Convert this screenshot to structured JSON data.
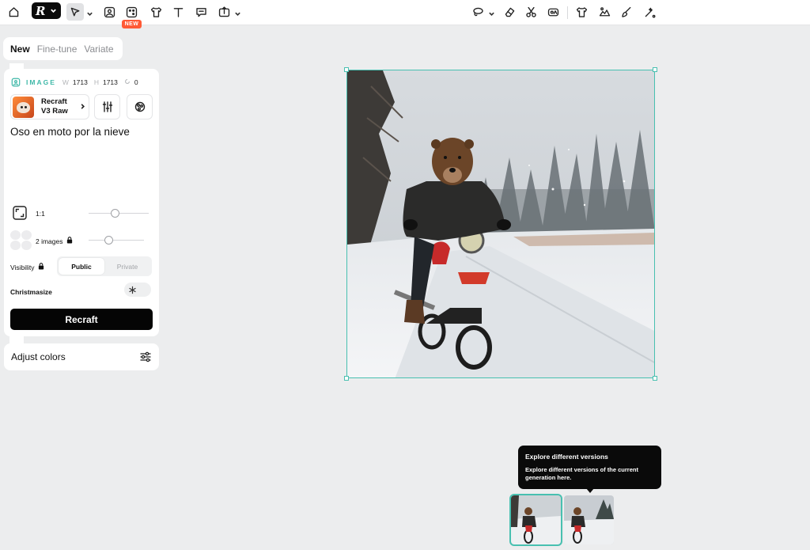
{
  "toolbar": {
    "tools": [
      {
        "name": "home-icon"
      },
      {
        "name": "logo"
      },
      {
        "name": "select-tool"
      },
      {
        "name": "image-tool"
      },
      {
        "name": "generate-tool"
      },
      {
        "name": "mockup-tool"
      },
      {
        "name": "text-tool"
      },
      {
        "name": "comment-tool"
      },
      {
        "name": "export-tool"
      }
    ],
    "new_badge": "NEW",
    "right_tools": [
      "lasso-icon",
      "eraser-icon",
      "scissors-icon",
      "vectorize-icon",
      "tshirt-icon",
      "background-icon",
      "brush-icon",
      "magic-icon"
    ]
  },
  "mode_tabs": [
    {
      "label": "New",
      "active": true
    },
    {
      "label": "Fine-tune",
      "active": false
    },
    {
      "label": "Variate",
      "active": false
    }
  ],
  "image_header": {
    "type": "IMAGE",
    "w_label": "W",
    "w_value": "1713",
    "h_label": "H",
    "h_value": "1713",
    "rotation": "0"
  },
  "model": {
    "name_line1": "Recraft",
    "name_line2": "V3 Raw"
  },
  "prompt": "Oso en moto por la nieve",
  "aspect": {
    "label": "1:1",
    "slider": 0.45
  },
  "count": {
    "label": "2 images",
    "slider": 0.35
  },
  "visibility": {
    "label": "Visibility",
    "options": [
      "Public",
      "Private"
    ],
    "selected": "Public"
  },
  "christmasize": {
    "label": "Christmasize"
  },
  "generate_button": "Recraft",
  "adjust_colors": "Adjust colors",
  "tooltip": {
    "title": "Explore different versions",
    "body": "Explore different versions of the current generation here."
  },
  "colors": {
    "accent": "#48c0b0",
    "badge": "#ff5a36",
    "button": "#050505"
  }
}
